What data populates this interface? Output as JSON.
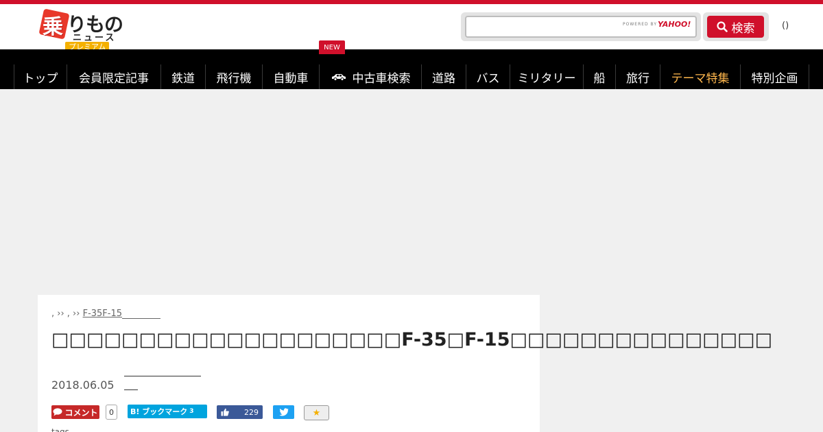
{
  "header": {
    "logo": {
      "kanji": "乗",
      "main": "りもの",
      "sub": "ニュース",
      "badge": "プレミアム"
    },
    "search": {
      "placeholder": "",
      "powered_by": "POWERED BY",
      "provider": "YAHOO!",
      "button_label": "検索"
    },
    "user_link": "()"
  },
  "nav": {
    "items": [
      {
        "label": "トップ"
      },
      {
        "label": "会員限定記事"
      },
      {
        "label": "鉄道"
      },
      {
        "label": "飛行機"
      },
      {
        "label": "自動車"
      },
      {
        "label": "中古車検索",
        "icon": "car-icon"
      },
      {
        "label": "道路"
      },
      {
        "label": "バス"
      },
      {
        "label": "ミリタリー"
      },
      {
        "label": "船"
      },
      {
        "label": "旅行"
      },
      {
        "label": "テーマ特集",
        "highlight": true
      },
      {
        "label": "特別企画"
      }
    ],
    "new_badge": "NEW"
  },
  "article": {
    "breadcrumb": {
      "prefix": ", ›› , ›› ",
      "link": "F-35F-15"
    },
    "title": "□□□□□□□□□□□□□□□□□□□□F-35□F-15□□□□□□□□□□□□□□□",
    "date": "2018.06.05",
    "share": {
      "comment_label": "コメント",
      "comment_count": "0",
      "hatena_label": "B! ブックマーク",
      "hatena_count": "3",
      "like_count": "229"
    },
    "tags_label": "tags"
  },
  "colors": {
    "brand_red": "#d0102b",
    "nav_bg": "#000000",
    "theme_highlight": "#ffb74d",
    "premium": "#f4b000"
  }
}
